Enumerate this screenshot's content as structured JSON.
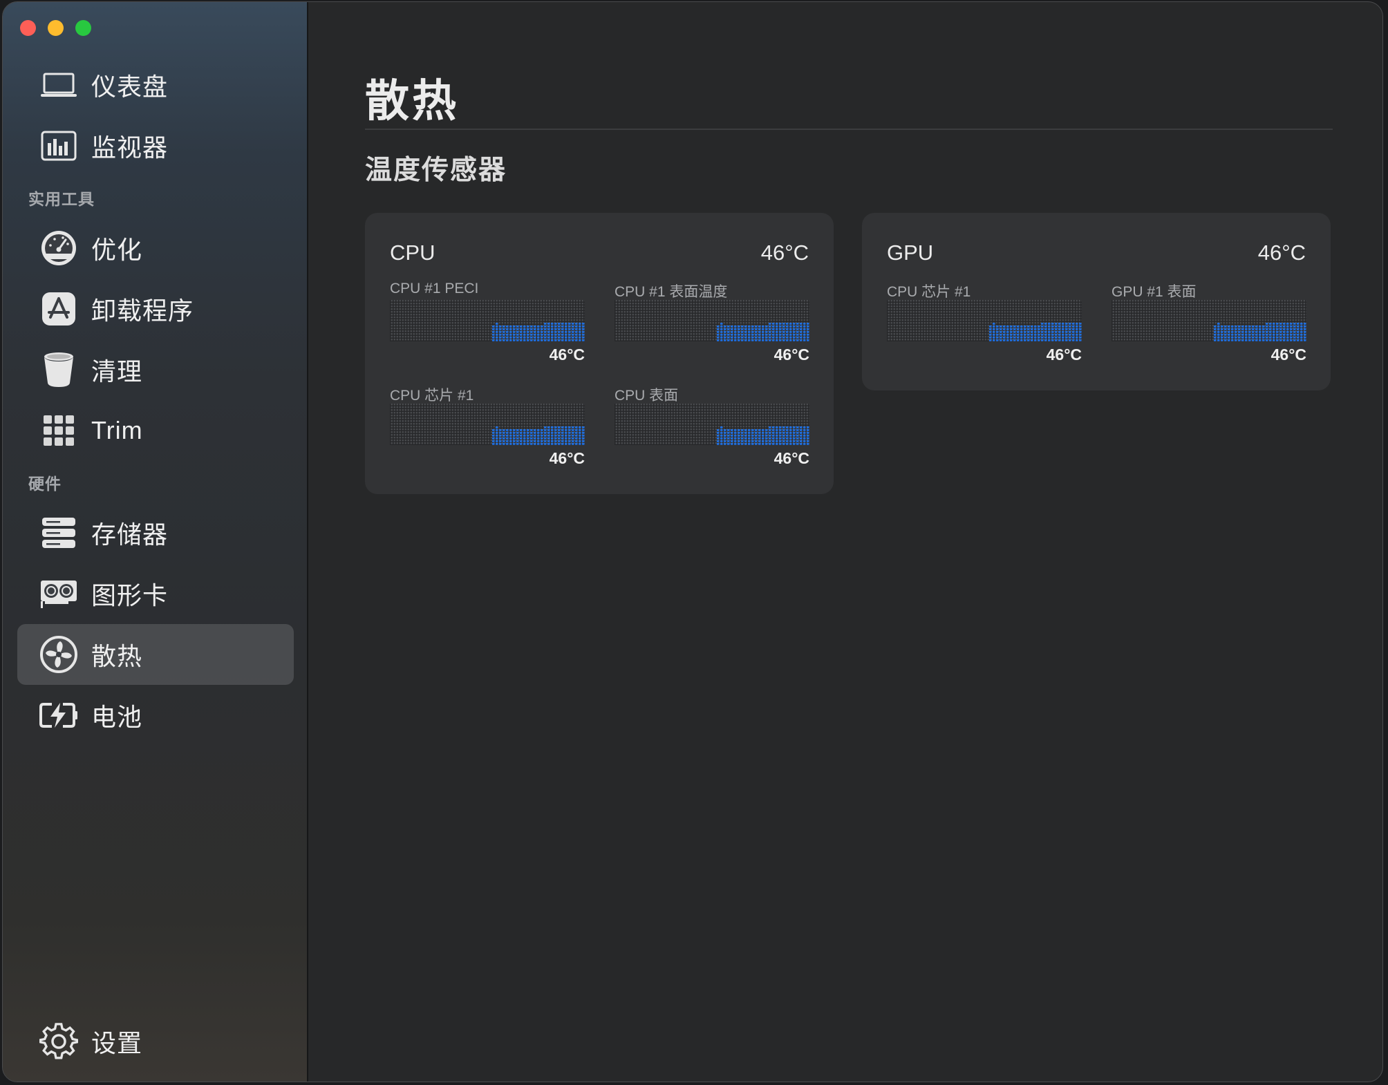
{
  "window": {
    "traffic_lights": [
      "close",
      "minimize",
      "maximize"
    ]
  },
  "sidebar": {
    "items_top": [
      {
        "id": "dashboard",
        "label": "仪表盘",
        "icon": "laptop-icon"
      },
      {
        "id": "monitor",
        "label": "监视器",
        "icon": "bar-chart-icon"
      }
    ],
    "section_tools": "实用工具",
    "items_tools": [
      {
        "id": "optimize",
        "label": "优化",
        "icon": "gauge-icon"
      },
      {
        "id": "uninstall",
        "label": "卸载程序",
        "icon": "app-store-icon"
      },
      {
        "id": "clean",
        "label": "清理",
        "icon": "trash-bin-icon"
      },
      {
        "id": "trim",
        "label": "Trim",
        "icon": "grid-icon"
      }
    ],
    "section_hardware": "硬件",
    "items_hardware": [
      {
        "id": "storage",
        "label": "存储器",
        "icon": "storage-icon"
      },
      {
        "id": "graphics",
        "label": "图形卡",
        "icon": "graphics-card-icon"
      },
      {
        "id": "cooling",
        "label": "散热",
        "icon": "fan-icon",
        "active": true
      },
      {
        "id": "battery",
        "label": "电池",
        "icon": "battery-icon"
      }
    ],
    "settings": {
      "label": "设置",
      "icon": "gear-icon"
    }
  },
  "main": {
    "title": "散热",
    "section": "温度传感器",
    "accent_color": "#1f6fe0",
    "cards": [
      {
        "name": "CPU",
        "temp": "46°C",
        "sensors": [
          {
            "label": "CPU #1 PECI",
            "value": "46°C"
          },
          {
            "label": "CPU #1 表面温度",
            "value": "46°C"
          },
          {
            "label": "CPU 芯片 #1",
            "value": "46°C"
          },
          {
            "label": "CPU 表面",
            "value": "46°C"
          }
        ]
      },
      {
        "name": "GPU",
        "temp": "46°C",
        "sensors": [
          {
            "label": "CPU 芯片 #1",
            "value": "46°C"
          },
          {
            "label": "GPU #1 表面",
            "value": "46°C"
          }
        ]
      }
    ]
  }
}
